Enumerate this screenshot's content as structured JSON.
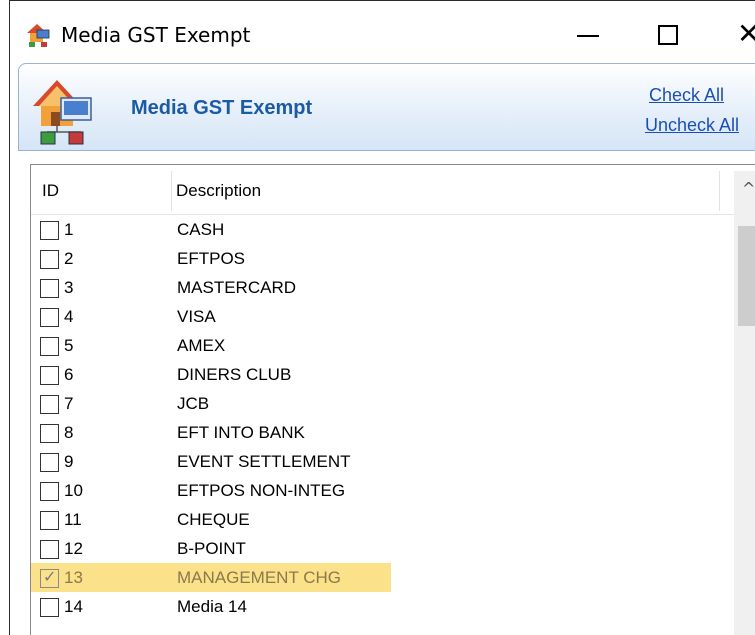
{
  "window": {
    "title": "Media GST Exempt",
    "minimize_glyph": "",
    "maximize_glyph": "",
    "close_glyph": "✕"
  },
  "banner": {
    "title": "Media GST Exempt",
    "check_all": "Check All",
    "uncheck_all": "Uncheck All"
  },
  "list": {
    "columns": {
      "id": "ID",
      "description": "Description"
    },
    "rows": [
      {
        "id": "1",
        "description": "CASH",
        "checked": false
      },
      {
        "id": "2",
        "description": "EFTPOS",
        "checked": false
      },
      {
        "id": "3",
        "description": "MASTERCARD",
        "checked": false
      },
      {
        "id": "4",
        "description": "VISA",
        "checked": false
      },
      {
        "id": "5",
        "description": "AMEX",
        "checked": false
      },
      {
        "id": "6",
        "description": "DINERS CLUB",
        "checked": false
      },
      {
        "id": "7",
        "description": "JCB",
        "checked": false
      },
      {
        "id": "8",
        "description": "EFT INTO BANK",
        "checked": false
      },
      {
        "id": "9",
        "description": "EVENT SETTLEMENT",
        "checked": false
      },
      {
        "id": "10",
        "description": "EFTPOS NON-INTEG",
        "checked": false
      },
      {
        "id": "11",
        "description": "CHEQUE",
        "checked": false
      },
      {
        "id": "12",
        "description": "B-POINT",
        "checked": false
      },
      {
        "id": "13",
        "description": "MANAGEMENT CHG",
        "checked": true,
        "highlighted": true
      },
      {
        "id": "14",
        "description": "Media 14",
        "checked": false
      }
    ]
  },
  "colors": {
    "banner_title": "#1b5aa5",
    "link": "#1b4fb8",
    "highlight": "#fbe18a"
  },
  "icons": {
    "title_icon": "network-house-icon",
    "banner_icon": "network-house-icon",
    "scroll_up": "chevron-up-icon"
  }
}
